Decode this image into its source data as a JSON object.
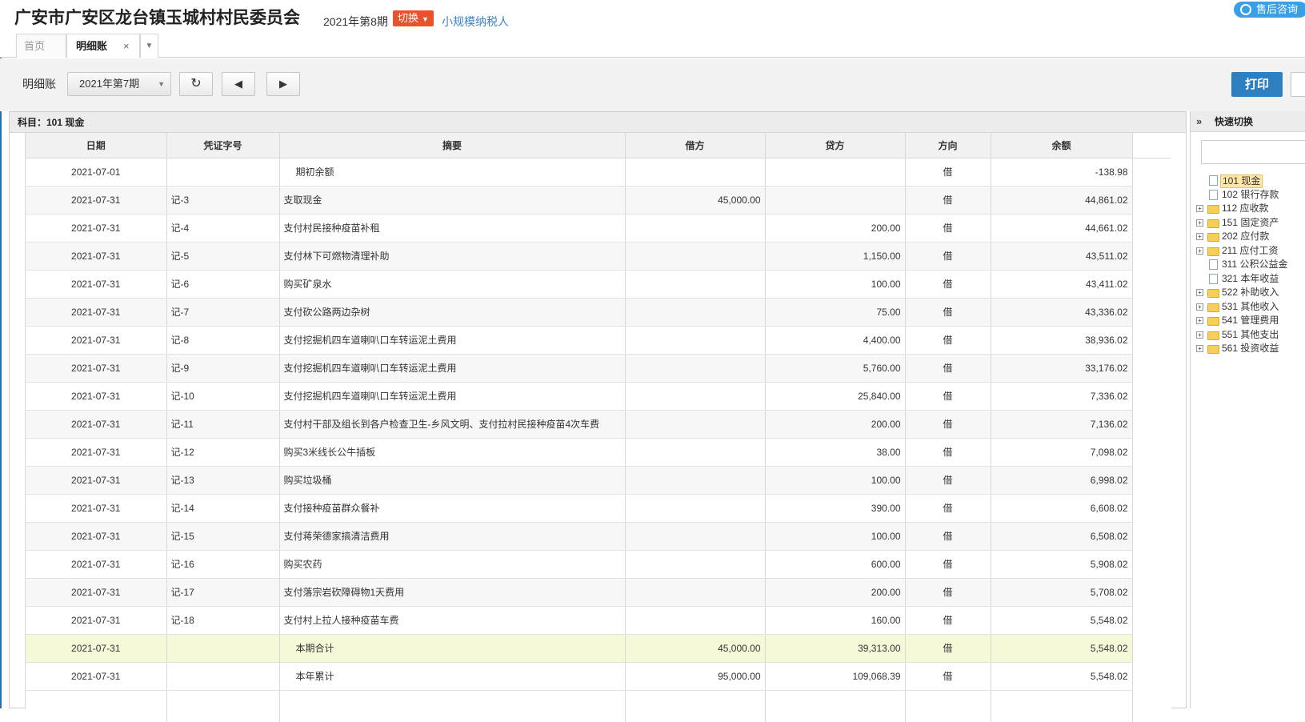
{
  "header": {
    "company": "广安市广安区龙台镇玉城村村民委员会",
    "period": "2021年第8期",
    "switch_label": "切换",
    "taxpayer": "小规模纳税人",
    "consult_label": "售后咨询"
  },
  "tabs": [
    {
      "label": "首页"
    },
    {
      "label": "明细账",
      "close": "×"
    }
  ],
  "toolbar": {
    "label": "明细账",
    "period_value": "2021年第7期",
    "print_label": "打印"
  },
  "panel": {
    "title": "科目：101  现金"
  },
  "table": {
    "columns": [
      "日期",
      "凭证字号",
      "摘要",
      "借方",
      "贷方",
      "方向",
      "余额"
    ],
    "rows": [
      {
        "date": "2021-07-01",
        "voucher": "",
        "summary": "期初余额",
        "debit": "",
        "credit": "",
        "dir": "借",
        "balance": "-138.98",
        "indent": true
      },
      {
        "date": "2021-07-31",
        "voucher": "记-3",
        "summary": "支取现金",
        "debit": "45,000.00",
        "credit": "",
        "dir": "借",
        "balance": "44,861.02"
      },
      {
        "date": "2021-07-31",
        "voucher": "记-4",
        "summary": "支付村民接种疫苗补租",
        "debit": "",
        "credit": "200.00",
        "dir": "借",
        "balance": "44,661.02"
      },
      {
        "date": "2021-07-31",
        "voucher": "记-5",
        "summary": "支付林下可燃物清理补助",
        "debit": "",
        "credit": "1,150.00",
        "dir": "借",
        "balance": "43,511.02"
      },
      {
        "date": "2021-07-31",
        "voucher": "记-6",
        "summary": "购买矿泉水",
        "debit": "",
        "credit": "100.00",
        "dir": "借",
        "balance": "43,411.02"
      },
      {
        "date": "2021-07-31",
        "voucher": "记-7",
        "summary": "支付砍公路两边杂树",
        "debit": "",
        "credit": "75.00",
        "dir": "借",
        "balance": "43,336.02"
      },
      {
        "date": "2021-07-31",
        "voucher": "记-8",
        "summary": "支付挖掘机四车道喇叭口车转运泥土费用",
        "debit": "",
        "credit": "4,400.00",
        "dir": "借",
        "balance": "38,936.02"
      },
      {
        "date": "2021-07-31",
        "voucher": "记-9",
        "summary": "支付挖掘机四车道喇叭口车转运泥土费用",
        "debit": "",
        "credit": "5,760.00",
        "dir": "借",
        "balance": "33,176.02"
      },
      {
        "date": "2021-07-31",
        "voucher": "记-10",
        "summary": "支付挖掘机四车道喇叭口车转运泥土费用",
        "debit": "",
        "credit": "25,840.00",
        "dir": "借",
        "balance": "7,336.02"
      },
      {
        "date": "2021-07-31",
        "voucher": "记-11",
        "summary": "支付村干部及组长到各户检查卫生-乡风文明、支付拉村民接种疫苗4次车费",
        "debit": "",
        "credit": "200.00",
        "dir": "借",
        "balance": "7,136.02"
      },
      {
        "date": "2021-07-31",
        "voucher": "记-12",
        "summary": "购买3米线长公牛插板",
        "debit": "",
        "credit": "38.00",
        "dir": "借",
        "balance": "7,098.02"
      },
      {
        "date": "2021-07-31",
        "voucher": "记-13",
        "summary": "购买垃圾桶",
        "debit": "",
        "credit": "100.00",
        "dir": "借",
        "balance": "6,998.02"
      },
      {
        "date": "2021-07-31",
        "voucher": "记-14",
        "summary": "支付接种疫苗群众餐补",
        "debit": "",
        "credit": "390.00",
        "dir": "借",
        "balance": "6,608.02"
      },
      {
        "date": "2021-07-31",
        "voucher": "记-15",
        "summary": "支付蒋荣德家搞清洁费用",
        "debit": "",
        "credit": "100.00",
        "dir": "借",
        "balance": "6,508.02"
      },
      {
        "date": "2021-07-31",
        "voucher": "记-16",
        "summary": "购买农药",
        "debit": "",
        "credit": "600.00",
        "dir": "借",
        "balance": "5,908.02"
      },
      {
        "date": "2021-07-31",
        "voucher": "记-17",
        "summary": "支付落宗岩砍障碍物1天费用",
        "debit": "",
        "credit": "200.00",
        "dir": "借",
        "balance": "5,708.02"
      },
      {
        "date": "2021-07-31",
        "voucher": "记-18",
        "summary": "支付村上拉人接种疫苗车费",
        "debit": "",
        "credit": "160.00",
        "dir": "借",
        "balance": "5,548.02"
      },
      {
        "date": "2021-07-31",
        "voucher": "",
        "summary": "本期合计",
        "debit": "45,000.00",
        "credit": "39,313.00",
        "dir": "借",
        "balance": "5,548.02",
        "indent": true,
        "total": true
      },
      {
        "date": "2021-07-31",
        "voucher": "",
        "summary": "本年累计",
        "debit": "95,000.00",
        "credit": "109,068.39",
        "dir": "借",
        "balance": "5,548.02",
        "indent": true
      }
    ]
  },
  "side": {
    "title": "快速切换",
    "collapse_icon": "»",
    "tree": [
      {
        "label": "101 现金",
        "type": "file",
        "selected": true,
        "expandable": false
      },
      {
        "label": "102 银行存款",
        "type": "file",
        "expandable": false
      },
      {
        "label": "112 应收款",
        "type": "folder",
        "expandable": true
      },
      {
        "label": "151 固定资产",
        "type": "folder",
        "expandable": true
      },
      {
        "label": "202 应付款",
        "type": "folder",
        "expandable": true
      },
      {
        "label": "211 应付工资",
        "type": "folder",
        "expandable": true
      },
      {
        "label": "311 公积公益金",
        "type": "file",
        "expandable": false
      },
      {
        "label": "321 本年收益",
        "type": "file",
        "expandable": false
      },
      {
        "label": "522 补助收入",
        "type": "folder",
        "expandable": true
      },
      {
        "label": "531 其他收入",
        "type": "folder",
        "expandable": true
      },
      {
        "label": "541 管理费用",
        "type": "folder",
        "expandable": true
      },
      {
        "label": "551 其他支出",
        "type": "folder",
        "expandable": true
      },
      {
        "label": "561 投资收益",
        "type": "folder",
        "expandable": true
      }
    ]
  },
  "colors": {
    "switch_bg": "#e9532b",
    "taxpayer_link": "#3a84c4",
    "consult_bg": "#3aa0e6",
    "print_bg": "#2e7fbf",
    "total_row_bg": "#f6f9d8"
  }
}
